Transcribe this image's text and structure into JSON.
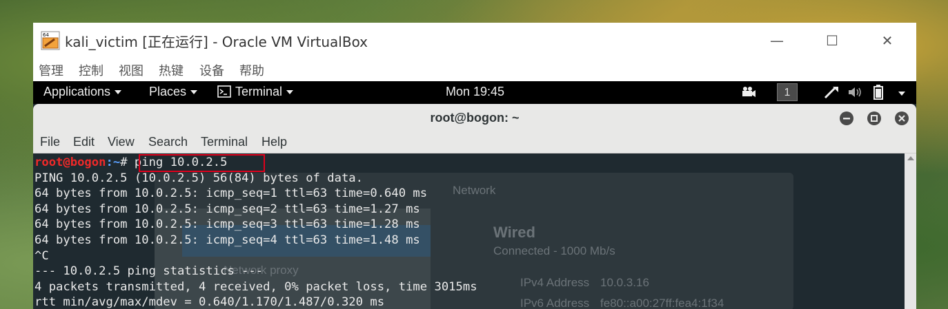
{
  "vbox": {
    "icon_badge": "64",
    "title": "kali_victim [正在运行] - Oracle VM VirtualBox",
    "controls": {
      "minimize": "—",
      "maximize": "☐",
      "close": "✕"
    },
    "menu": [
      "管理",
      "控制",
      "视图",
      "热键",
      "设备",
      "帮助"
    ]
  },
  "topbar": {
    "applications": "Applications",
    "places": "Places",
    "terminal": "Terminal",
    "clock": "Mon 19:45",
    "workspace": "1"
  },
  "terminal": {
    "title": "root@bogon: ~",
    "menu": [
      "File",
      "Edit",
      "View",
      "Search",
      "Terminal",
      "Help"
    ],
    "prompt_user": "root@bogon",
    "prompt_path": ":~",
    "prompt_symbol": "# ",
    "command": "ping 10.0.2.5",
    "output": [
      "PING 10.0.2.5 (10.0.2.5) 56(84) bytes of data.",
      "64 bytes from 10.0.2.5: icmp_seq=1 ttl=63 time=0.640 ms",
      "64 bytes from 10.0.2.5: icmp_seq=2 ttl=63 time=1.27 ms",
      "64 bytes from 10.0.2.5: icmp_seq=3 ttl=63 time=1.28 ms",
      "64 bytes from 10.0.2.5: icmp_seq=4 ttl=63 time=1.48 ms",
      "^C",
      "--- 10.0.2.5 ping statistics ---",
      "4 packets transmitted, 4 received, 0% packet loss, time 3015ms",
      "rtt min/avg/max/mdev = 0.640/1.170/1.487/0.320 ms"
    ]
  },
  "background_dialog": {
    "title": "Network",
    "wired": "Wired",
    "status": "Connected - 1000 Mb/s",
    "ipv4_label": "IPv4 Address",
    "ipv4_value": "10.0.3.16",
    "ipv6_label": "IPv6 Address",
    "ipv6_value": "fe80::a00:27ff:fea4:1f34",
    "proxy": "Network proxy"
  }
}
